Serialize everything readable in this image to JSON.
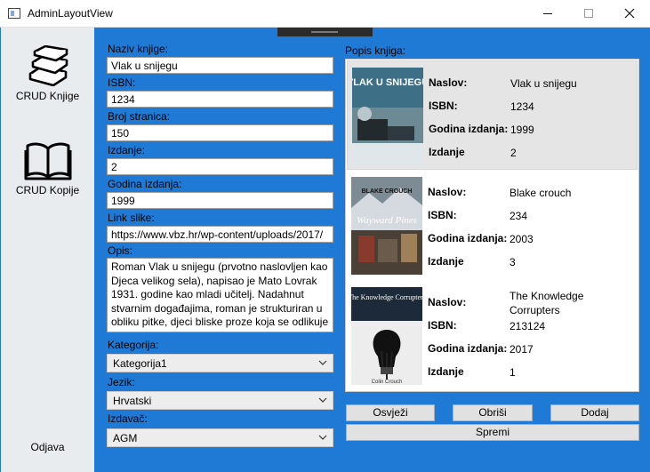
{
  "window": {
    "title": "AdminLayoutView"
  },
  "sidebar": {
    "items": [
      {
        "label": "CRUD Knjige",
        "icon": "books-stack-icon"
      },
      {
        "label": "CRUD Kopije",
        "icon": "open-book-icon"
      }
    ],
    "logout_label": "Odjava"
  },
  "form": {
    "title_label": "Naziv knjige:",
    "title_value": "Vlak u snijegu",
    "isbn_label": "ISBN:",
    "isbn_value": "1234",
    "pages_label": "Broj stranica:",
    "pages_value": "150",
    "edition_label": "Izdanje:",
    "edition_value": "2",
    "year_label": "Godina izdanja:",
    "year_value": "1999",
    "image_label": "Link slike:",
    "image_value": "https://www.vbz.hr/wp-content/uploads/2017/",
    "desc_label": "Opis:",
    "desc_value": "Roman Vlak u snijegu (prvotno naslovljen kao Djeca velikog sela), napisao je Mato Lovrak 1931. godine kao mladi učitelj. Nadahnut stvarnim događajima, roman je strukturiran u obliku pitke, djeci bliske proze koja se odlikuje",
    "category_label": "Kategorija:",
    "category_value": "Kategorija1",
    "language_label": "Jezik:",
    "language_value": "Hrvatski",
    "publisher_label": "Izdavač:",
    "publisher_value": "AGM"
  },
  "book_list": {
    "title": "Popis knjiga:",
    "field_labels": {
      "title": "Naslov:",
      "isbn": "ISBN:",
      "year": "Godina izdanja:",
      "edition": "Izdanje"
    },
    "items": [
      {
        "title": "Vlak u snijegu",
        "isbn": "1234",
        "year": "1999",
        "edition": "2",
        "cover_text": "VLAK U SNIJEGU",
        "selected": true
      },
      {
        "title": "Blake crouch",
        "isbn": "234",
        "year": "2003",
        "edition": "3",
        "cover_text": "Wayward Pines",
        "cover_author": "BLAKE CROUCH",
        "selected": false
      },
      {
        "title": "The Knowledge Corrupters",
        "isbn": "213124",
        "year": "2017",
        "edition": "1",
        "cover_text": "The Knowledge Corrupters",
        "cover_author": "Colin Crouch",
        "selected": false
      }
    ]
  },
  "buttons": {
    "refresh": "Osvježi",
    "delete": "Obriši",
    "add": "Dodaj",
    "save": "Spremi"
  },
  "colors": {
    "background": "#1e7ad4",
    "sidebar": "#e9ecef",
    "selected_row": "#e5e5e5"
  }
}
